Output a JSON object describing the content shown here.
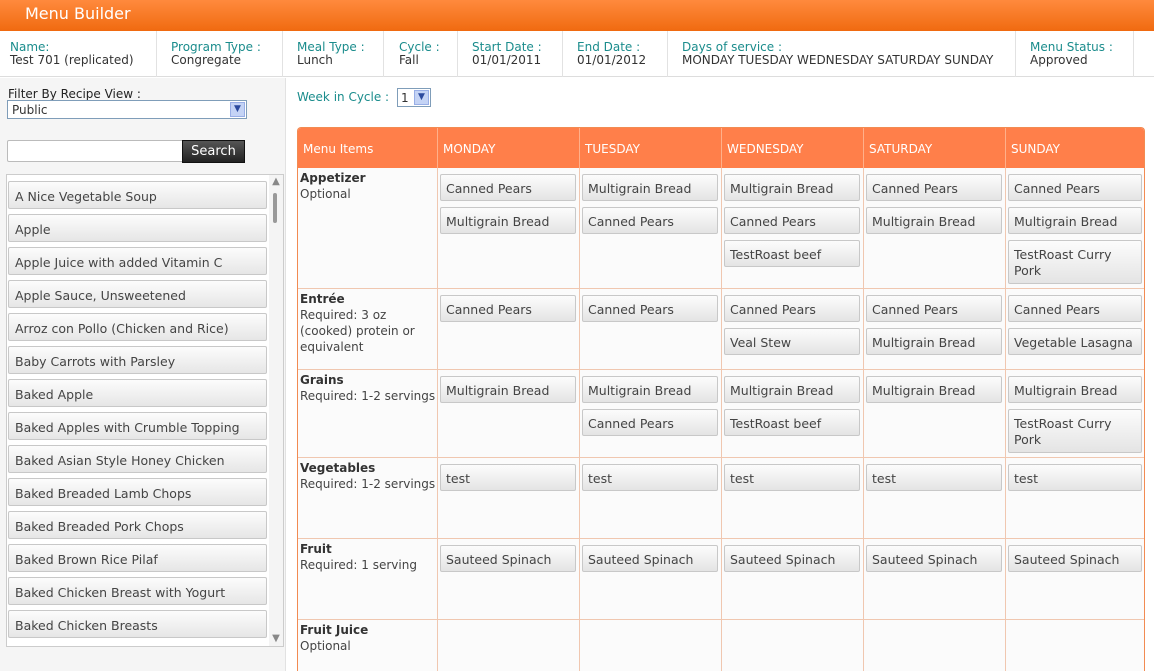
{
  "app": {
    "title": "Menu Builder"
  },
  "info": [
    {
      "label": "Name:",
      "value": "Test 701 (replicated)"
    },
    {
      "label": "Program Type :",
      "value": "Congregate"
    },
    {
      "label": "Meal Type :",
      "value": "Lunch"
    },
    {
      "label": "Cycle :",
      "value": "Fall"
    },
    {
      "label": "Start Date :",
      "value": "01/01/2011"
    },
    {
      "label": "End Date :",
      "value": "01/01/2012"
    },
    {
      "label": "Days of service :",
      "value": "MONDAY TUESDAY WEDNESDAY SATURDAY SUNDAY"
    },
    {
      "label": "Menu Status :",
      "value": "Approved"
    }
  ],
  "sidebar": {
    "filter_label": "Filter By Recipe View :",
    "filter_value": "Public",
    "search_placeholder": "",
    "search_label": "Search",
    "recipes": [
      "A Nice Vegetable Soup",
      "Apple",
      "Apple Juice with added Vitamin C",
      "Apple Sauce, Unsweetened",
      "Arroz con Pollo (Chicken and Rice)",
      "Baby Carrots with Parsley",
      "Baked Apple",
      "Baked Apples with Crumble Topping",
      "Baked Asian Style Honey Chicken",
      "Baked Breaded Lamb Chops",
      "Baked Breaded Pork Chops",
      "Baked Brown Rice Pilaf",
      "Baked Chicken Breast with Yogurt",
      "Baked Chicken Breasts"
    ]
  },
  "week": {
    "label": "Week in Cycle :",
    "value": "1"
  },
  "grid": {
    "header": [
      "Menu Items",
      "MONDAY",
      "TUESDAY",
      "WEDNESDAY",
      "SATURDAY",
      "SUNDAY"
    ],
    "rows": [
      {
        "name": "Appetizer",
        "req": "Optional",
        "days": [
          [
            "Canned Pears",
            "Multigrain Bread"
          ],
          [
            "Multigrain Bread",
            "Canned Pears"
          ],
          [
            "Multigrain Bread",
            "Canned Pears",
            "TestRoast beef"
          ],
          [
            "Canned Pears",
            "Multigrain Bread"
          ],
          [
            "Canned Pears",
            "Multigrain Bread",
            "TestRoast Curry Pork"
          ]
        ]
      },
      {
        "name": "Entrée",
        "req": "Required: 3 oz (cooked) protein or equivalent",
        "days": [
          [
            "Canned Pears"
          ],
          [
            "Canned Pears"
          ],
          [
            "Canned Pears",
            "Veal Stew"
          ],
          [
            "Canned Pears",
            "Multigrain Bread"
          ],
          [
            "Canned Pears",
            "Vegetable Lasagna"
          ]
        ]
      },
      {
        "name": "Grains",
        "req": "Required: 1-2 servings",
        "days": [
          [
            "Multigrain Bread"
          ],
          [
            "Multigrain Bread",
            "Canned Pears"
          ],
          [
            "Multigrain Bread",
            "TestRoast beef"
          ],
          [
            "Multigrain Bread"
          ],
          [
            "Multigrain Bread",
            "TestRoast Curry Pork"
          ]
        ]
      },
      {
        "name": "Vegetables",
        "req": "Required: 1-2 servings",
        "days": [
          [
            "test"
          ],
          [
            "test"
          ],
          [
            "test"
          ],
          [
            "test"
          ],
          [
            "test"
          ]
        ]
      },
      {
        "name": "Fruit",
        "req": "Required: 1 serving",
        "days": [
          [
            "Sauteed Spinach"
          ],
          [
            "Sauteed Spinach"
          ],
          [
            "Sauteed Spinach"
          ],
          [
            "Sauteed Spinach"
          ],
          [
            "Sauteed Spinach"
          ]
        ]
      },
      {
        "name": "Fruit Juice",
        "req": "Optional",
        "days": [
          [],
          [],
          [],
          [],
          []
        ]
      }
    ]
  }
}
